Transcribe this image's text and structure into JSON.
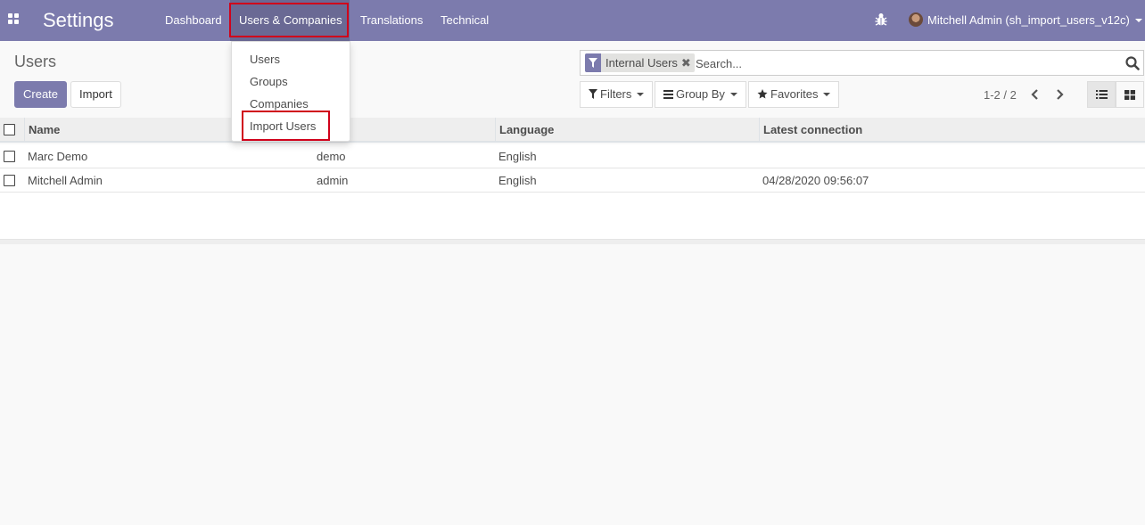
{
  "navbar": {
    "brand": "Settings",
    "menu": [
      "Dashboard",
      "Users & Companies",
      "Translations",
      "Technical"
    ],
    "user": "Mitchell Admin (sh_import_users_v12c)",
    "bg_color": "#7c7bad",
    "icons": {
      "apps": "apps-grid-icon",
      "debug": "bug-icon"
    }
  },
  "dropdown": {
    "items": [
      "Users",
      "Groups",
      "Companies",
      "Import Users"
    ]
  },
  "control_panel": {
    "breadcrumb": "Users",
    "create_label": "Create",
    "import_label": "Import",
    "search": {
      "facet": "Internal Users",
      "placeholder": "Search..."
    },
    "filters_label": "Filters",
    "groupby_label": "Group By",
    "favorites_label": "Favorites",
    "pager": "1-2 / 2"
  },
  "table": {
    "headers": [
      "Name",
      "Language",
      "Latest connection"
    ],
    "rows": [
      {
        "name": "Marc Demo",
        "login": "demo",
        "lang": "English",
        "last": ""
      },
      {
        "name": "Mitchell Admin",
        "login": "admin",
        "lang": "English",
        "last": "04/28/2020 09:56:07"
      }
    ]
  },
  "colors": {
    "primary": "#7c7bad",
    "highlight": "#d0021b"
  }
}
